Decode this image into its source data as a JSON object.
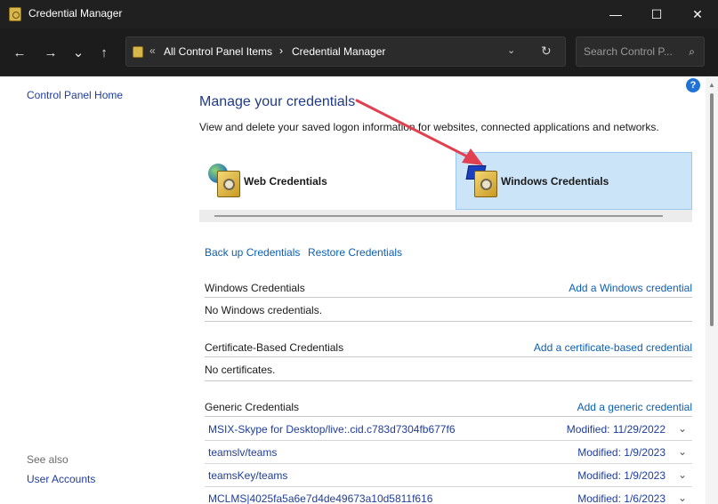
{
  "window": {
    "title": "Credential Manager",
    "controls": {
      "minimize": "—",
      "maximize": "☐",
      "close": "✕"
    }
  },
  "nav": {
    "back": "←",
    "forward": "→",
    "recent": "⌄",
    "up": "↑",
    "address_separator": "«",
    "breadcrumbs": [
      "All Control Panel Items",
      "Credential Manager"
    ],
    "breadcrumb_arrow": "›",
    "dropdown": "⌄",
    "refresh": "↻",
    "search_placeholder": "Search Control P...",
    "search_icon": "⌕"
  },
  "left": {
    "home_link": "Control Panel Home",
    "see_also": "See also",
    "user_accounts": "User Accounts"
  },
  "main": {
    "help": "?",
    "title": "Manage your credentials",
    "description": "View and delete your saved logon information for websites, connected applications and networks.",
    "cred_types": {
      "web": "Web Credentials",
      "windows": "Windows Credentials",
      "selected": "windows"
    },
    "backup_link": "Back up Credentials",
    "restore_link": "Restore Credentials",
    "sections": {
      "windows": {
        "name": "Windows Credentials",
        "action": "Add a Windows credential",
        "empty": "No Windows credentials."
      },
      "certificate": {
        "name": "Certificate-Based Credentials",
        "action": "Add a certificate-based credential",
        "empty": "No certificates."
      },
      "generic": {
        "name": "Generic Credentials",
        "action": "Add a generic credential",
        "items": [
          {
            "name": "MSIX-Skype for Desktop/live:.cid.c783d7304fb677f6",
            "modified": "Modified:  11/29/2022"
          },
          {
            "name": "teamslv/teams",
            "modified": "Modified:  1/9/2023"
          },
          {
            "name": "teamsKey/teams",
            "modified": "Modified:  1/9/2023"
          },
          {
            "name": "MCLMS|4025fa5a6e7d4de49673a10d5811f616",
            "modified": "Modified:  1/6/2023"
          }
        ]
      }
    }
  },
  "colors": {
    "titlebar": "#202020",
    "navbar": "#1c1c1c",
    "link": "#1f3d99",
    "selected_tab": "#cce4f7",
    "annotation": "#e0404f"
  }
}
